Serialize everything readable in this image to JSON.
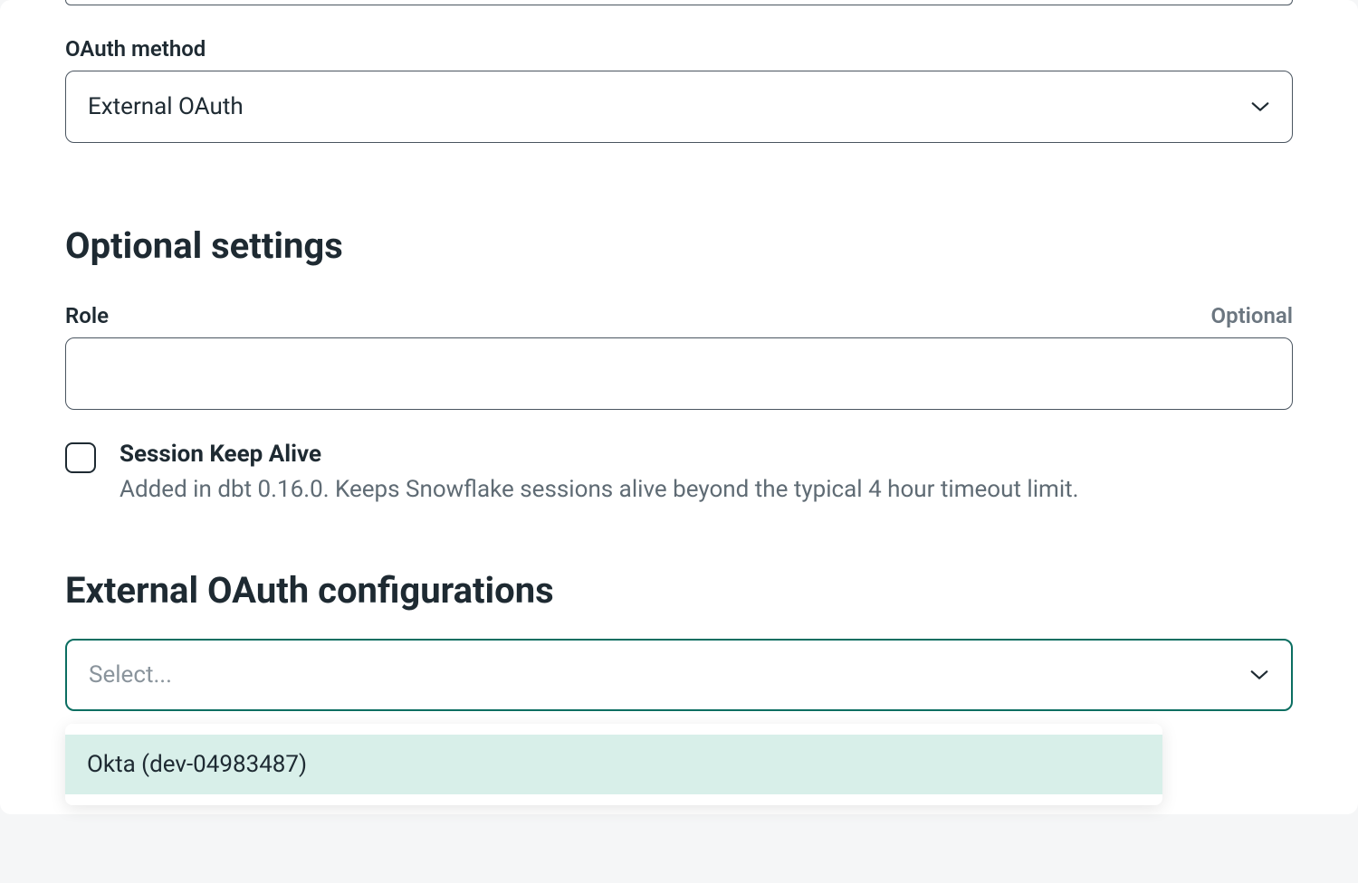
{
  "oauth_method": {
    "label": "OAuth method",
    "value": "External OAuth"
  },
  "optional_section": {
    "heading": "Optional settings",
    "role": {
      "label": "Role",
      "optional_tag": "Optional",
      "value": ""
    },
    "session_keep_alive": {
      "label": "Session Keep Alive",
      "description": "Added in dbt 0.16.0. Keeps Snowflake sessions alive beyond the typical 4 hour timeout limit.",
      "checked": false
    }
  },
  "external_oauth": {
    "heading": "External OAuth configurations",
    "placeholder": "Select...",
    "options": [
      {
        "label": "Okta (dev-04983487)"
      }
    ]
  }
}
